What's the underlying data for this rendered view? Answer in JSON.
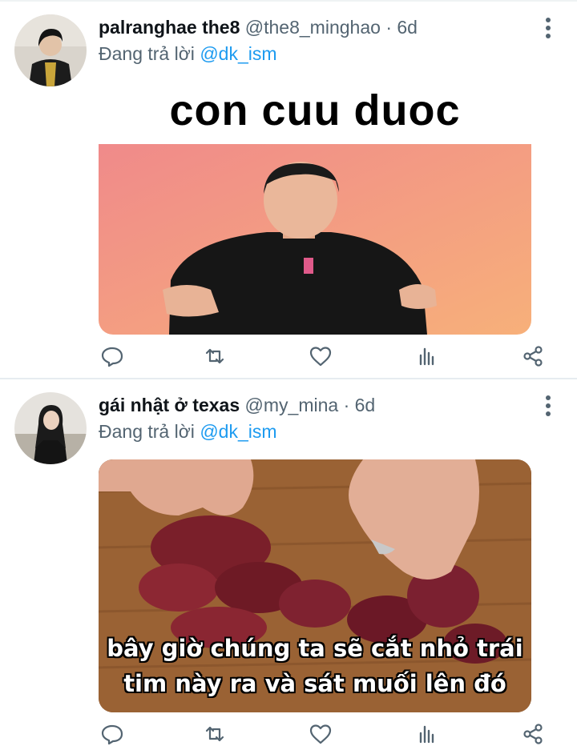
{
  "tweets": [
    {
      "display_name": "palranghae the8",
      "handle": "@the8_minghao",
      "separator": "·",
      "time": "6d",
      "replying_prefix": "Đang trả lời",
      "replying_to": "@dk_ism",
      "media_caption": "con cuu duoc"
    },
    {
      "display_name": "gái nhật ở texas",
      "handle": "@my_mina",
      "separator": "·",
      "time": "6d",
      "replying_prefix": "Đang trả lời",
      "replying_to": "@dk_ism",
      "media_subtitle_line1": "bây giờ chúng ta sẽ cắt nhỏ trái",
      "media_subtitle_line2": "tim này ra và sát muối lên đó"
    }
  ],
  "icons": [
    "reply-icon",
    "retweet-icon",
    "like-icon",
    "analytics-icon",
    "share-icon",
    "more-icon"
  ],
  "colors": {
    "link": "#1d9bf0",
    "secondary_text": "#536471",
    "divider": "#e6ecf0"
  }
}
